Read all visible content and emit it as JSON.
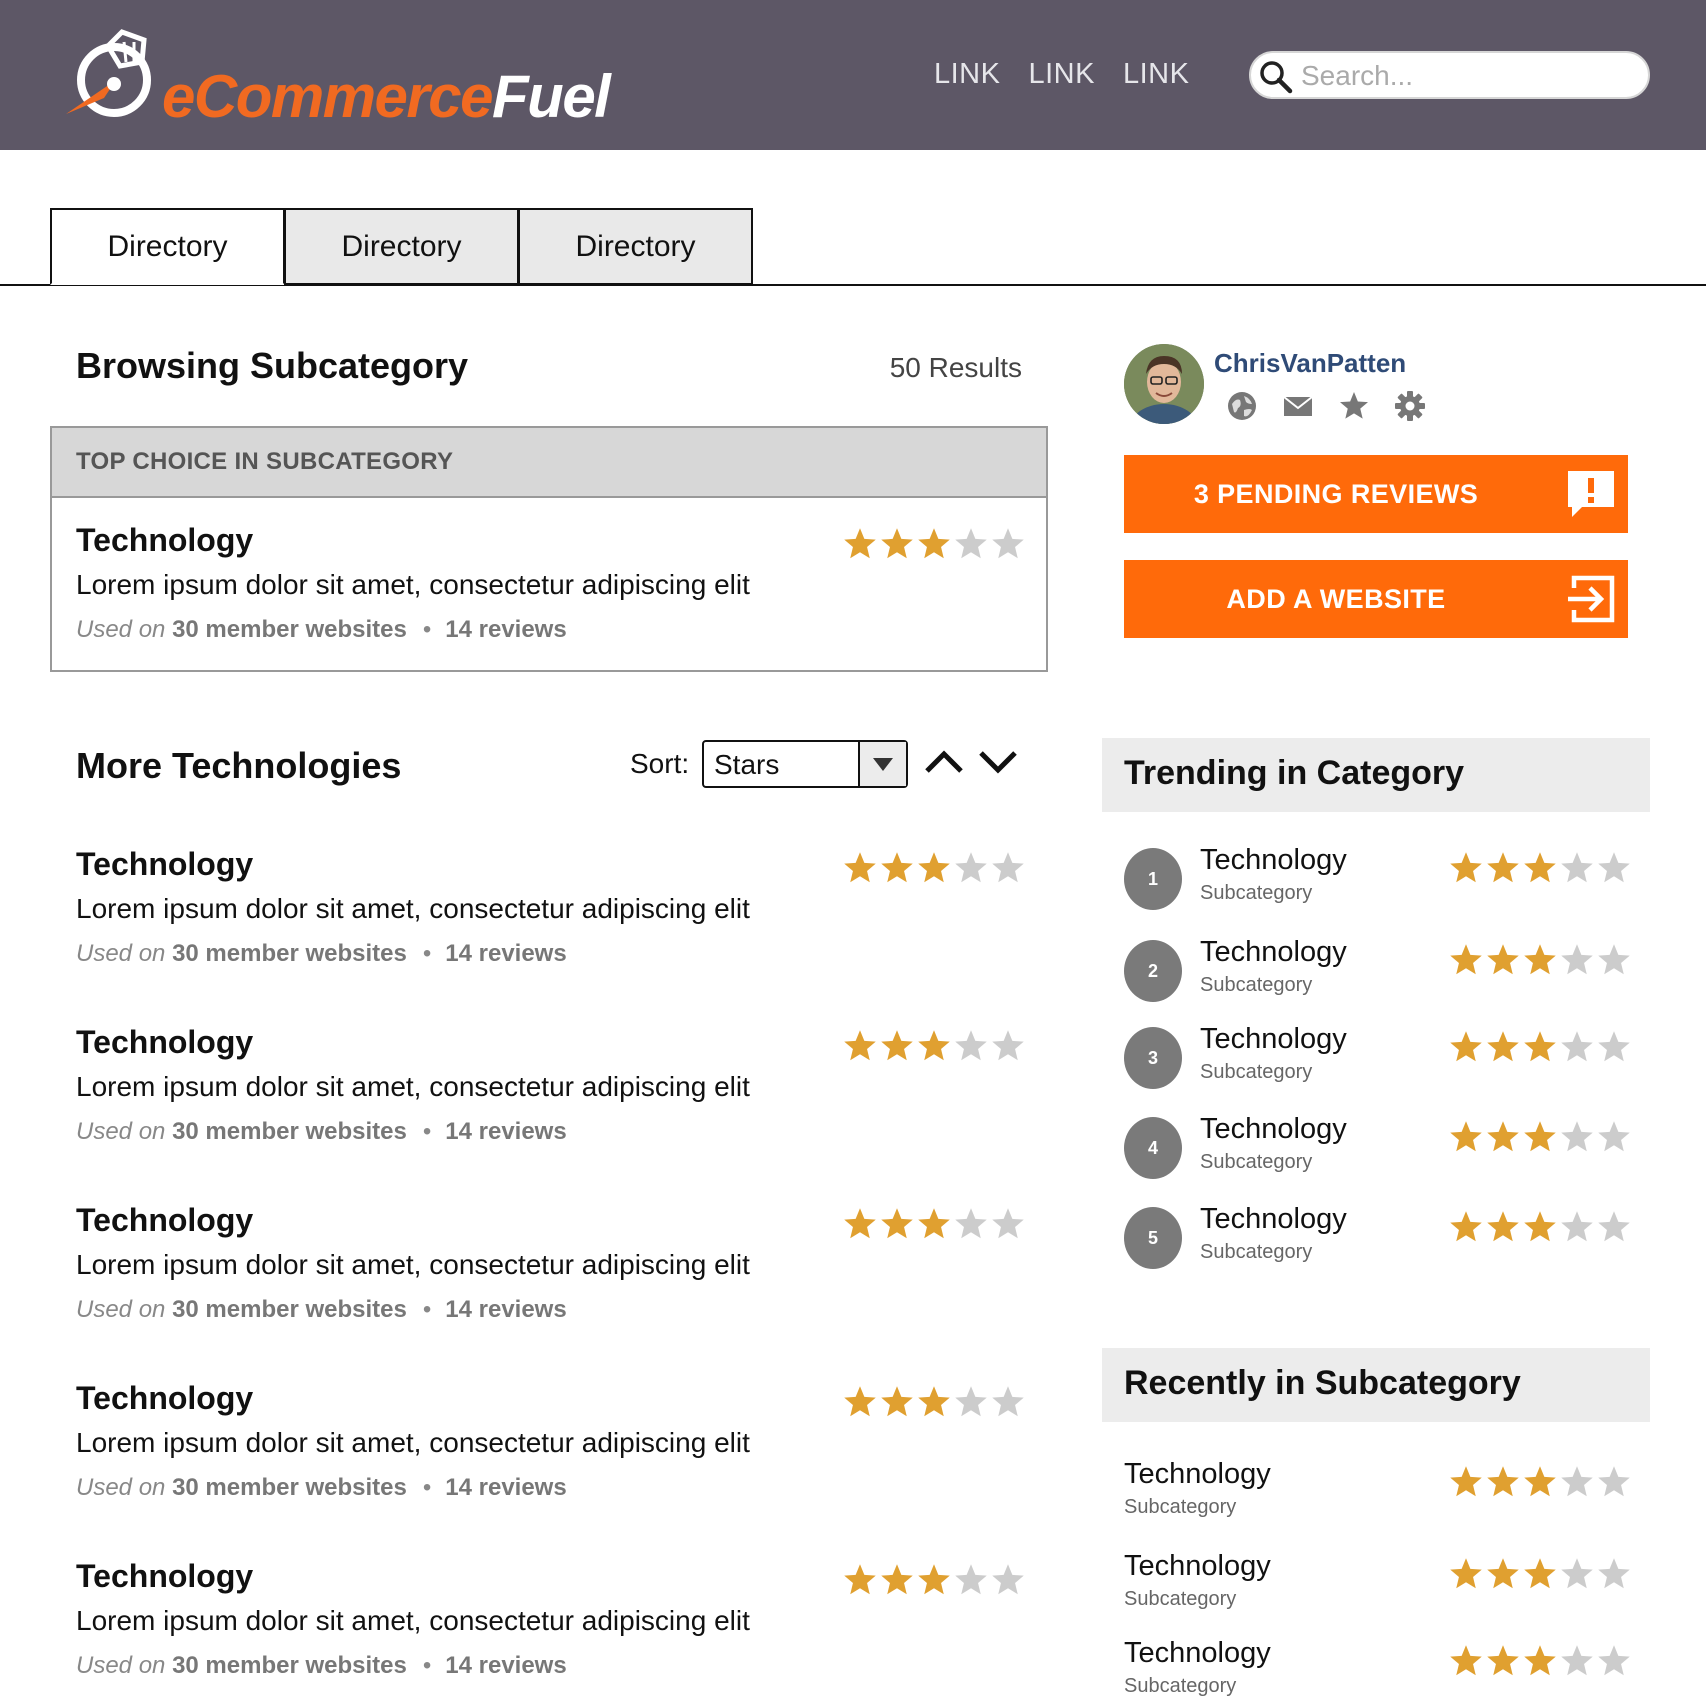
{
  "header": {
    "logo_part1": "eCommerce",
    "logo_part2": "Fuel",
    "nav_links": [
      "LINK",
      "LINK",
      "LINK"
    ],
    "search_placeholder": "Search..."
  },
  "tabs": [
    "Directory",
    "Directory",
    "Directory"
  ],
  "main": {
    "title": "Browsing Subcategory",
    "results": "50 Results",
    "top_choice": {
      "header": "TOP CHOICE IN SUBCATEGORY",
      "item": {
        "title": "Technology",
        "description": "Lorem ipsum dolor sit amet, consectetur adipiscing elit",
        "used_on": "Used on",
        "members": "30 member websites",
        "reviews": "14 reviews",
        "rating": 3
      }
    },
    "more_title": "More Technologies",
    "sort_label": "Sort:",
    "sort_value": "Stars",
    "list": [
      {
        "title": "Technology",
        "description": "Lorem ipsum dolor sit amet, consectetur adipiscing elit",
        "used_on": "Used on",
        "members": "30 member websites",
        "reviews": "14 reviews",
        "rating": 3
      },
      {
        "title": "Technology",
        "description": "Lorem ipsum dolor sit amet, consectetur adipiscing elit",
        "used_on": "Used on",
        "members": "30 member websites",
        "reviews": "14 reviews",
        "rating": 3
      },
      {
        "title": "Technology",
        "description": "Lorem ipsum dolor sit amet, consectetur adipiscing elit",
        "used_on": "Used on",
        "members": "30 member websites",
        "reviews": "14 reviews",
        "rating": 3
      },
      {
        "title": "Technology",
        "description": "Lorem ipsum dolor sit amet, consectetur adipiscing elit",
        "used_on": "Used on",
        "members": "30 member websites",
        "reviews": "14 reviews",
        "rating": 3
      },
      {
        "title": "Technology",
        "description": "Lorem ipsum dolor sit amet, consectetur adipiscing elit",
        "used_on": "Used on",
        "members": "30 member websites",
        "reviews": "14 reviews",
        "rating": 3
      }
    ]
  },
  "sidebar": {
    "username": "ChrisVanPatten",
    "user_icons": [
      "globe-icon",
      "mail-icon",
      "star-icon",
      "gear-icon"
    ],
    "pending_button": "3 PENDING REVIEWS",
    "add_button": "ADD A WEBSITE",
    "trending_title": "Trending in Category",
    "trending": [
      {
        "rank": "1",
        "title": "Technology",
        "sub": "Subcategory",
        "rating": 3
      },
      {
        "rank": "2",
        "title": "Technology",
        "sub": "Subcategory",
        "rating": 3
      },
      {
        "rank": "3",
        "title": "Technology",
        "sub": "Subcategory",
        "rating": 3
      },
      {
        "rank": "4",
        "title": "Technology",
        "sub": "Subcategory",
        "rating": 3
      },
      {
        "rank": "5",
        "title": "Technology",
        "sub": "Subcategory",
        "rating": 3
      }
    ],
    "recent_title": "Recently in Subcategory",
    "recent": [
      {
        "title": "Technology",
        "sub": "Subcategory",
        "rating": 3
      },
      {
        "title": "Technology",
        "sub": "Subcategory",
        "rating": 3
      },
      {
        "title": "Technology",
        "sub": "Subcategory",
        "rating": 3
      }
    ]
  },
  "colors": {
    "header_bg": "#5d5766",
    "accent_orange": "#ff6a0a",
    "star_filled": "#e0a030",
    "star_empty": "#cccccc",
    "username": "#2f4b77"
  }
}
